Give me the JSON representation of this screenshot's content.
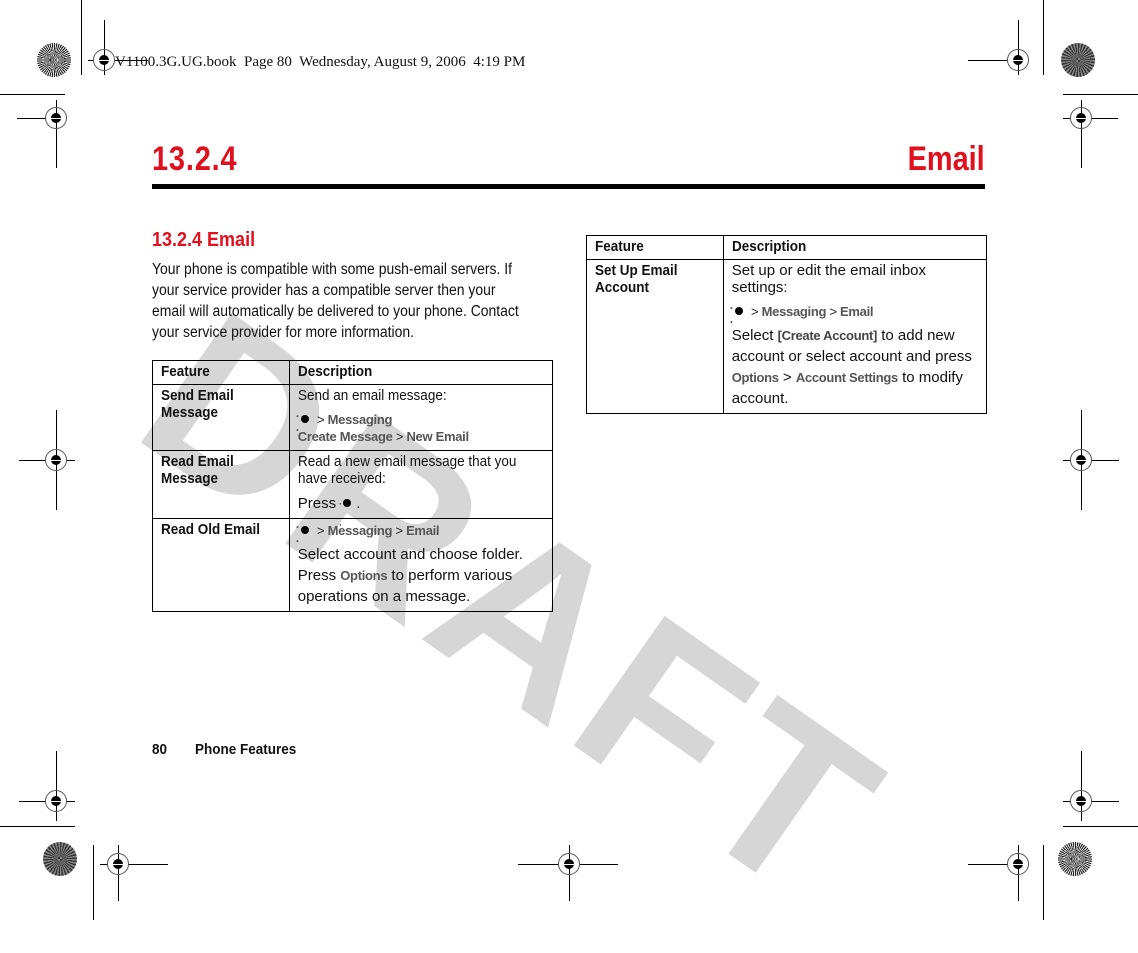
{
  "print_header": "V1100.3G.UG.book  Page 80  Wednesday, August 9, 2006  4:19 PM",
  "chapter": {
    "number": "13.2.4",
    "title": "Email"
  },
  "watermark": "DRAFT",
  "section": {
    "title": "13.2.4 Email",
    "intro": "Your phone is compatible with some push-email servers. If your service provider has a compatible server then your email will automatically be delivered to your phone. Contact your service provider for more information."
  },
  "table_left": {
    "headers": [
      "Feature",
      "Description"
    ],
    "rows": [
      {
        "feature": "Send Email Message",
        "desc": "Send an email message:",
        "path1": [
          "Messaging"
        ],
        "path2": [
          "Create Message",
          "New Email"
        ]
      },
      {
        "feature": "Read Email Message",
        "desc": "Read a new email message that you have received:",
        "press": "Press",
        "press_end": "."
      },
      {
        "feature": "Read Old Email",
        "path1": [
          "Messaging",
          "Email"
        ],
        "desc_pre": "Select account and choose folder. Press ",
        "desc_key": "Options",
        "desc_post": " to perform various operations on a message."
      }
    ]
  },
  "table_right": {
    "headers": [
      "Feature",
      "Description"
    ],
    "rows": [
      {
        "feature": "Set Up Email Account",
        "desc": "Set up or edit the email inbox settings:",
        "path1": [
          "Messaging",
          "Email"
        ],
        "sel_pre": "Select ",
        "sel_key": "[Create Account]",
        "sel_mid": " to add new account or select account and press ",
        "key1": "Options",
        "key2": "Account Settings",
        "sel_post": " to modify account."
      }
    ]
  },
  "path_separator": ">",
  "footer": {
    "page": "80",
    "section": "Phone Features"
  }
}
